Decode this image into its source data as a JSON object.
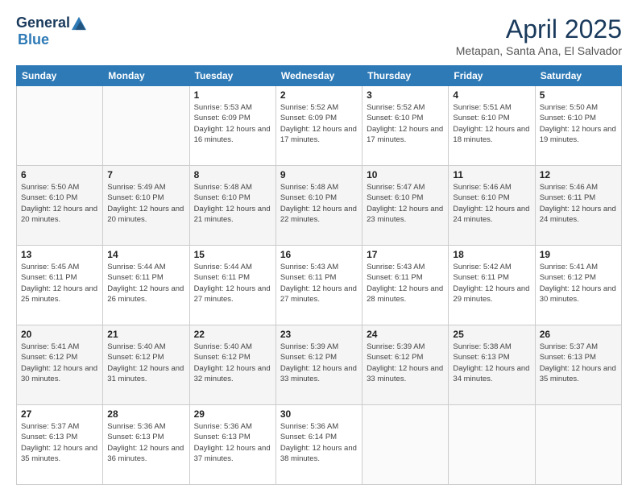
{
  "logo": {
    "general": "General",
    "blue": "Blue"
  },
  "header": {
    "title": "April 2025",
    "location": "Metapan, Santa Ana, El Salvador"
  },
  "days_of_week": [
    "Sunday",
    "Monday",
    "Tuesday",
    "Wednesday",
    "Thursday",
    "Friday",
    "Saturday"
  ],
  "weeks": [
    [
      {
        "num": "",
        "info": ""
      },
      {
        "num": "",
        "info": ""
      },
      {
        "num": "1",
        "info": "Sunrise: 5:53 AM\nSunset: 6:09 PM\nDaylight: 12 hours and 16 minutes."
      },
      {
        "num": "2",
        "info": "Sunrise: 5:52 AM\nSunset: 6:09 PM\nDaylight: 12 hours and 17 minutes."
      },
      {
        "num": "3",
        "info": "Sunrise: 5:52 AM\nSunset: 6:10 PM\nDaylight: 12 hours and 17 minutes."
      },
      {
        "num": "4",
        "info": "Sunrise: 5:51 AM\nSunset: 6:10 PM\nDaylight: 12 hours and 18 minutes."
      },
      {
        "num": "5",
        "info": "Sunrise: 5:50 AM\nSunset: 6:10 PM\nDaylight: 12 hours and 19 minutes."
      }
    ],
    [
      {
        "num": "6",
        "info": "Sunrise: 5:50 AM\nSunset: 6:10 PM\nDaylight: 12 hours and 20 minutes."
      },
      {
        "num": "7",
        "info": "Sunrise: 5:49 AM\nSunset: 6:10 PM\nDaylight: 12 hours and 20 minutes."
      },
      {
        "num": "8",
        "info": "Sunrise: 5:48 AM\nSunset: 6:10 PM\nDaylight: 12 hours and 21 minutes."
      },
      {
        "num": "9",
        "info": "Sunrise: 5:48 AM\nSunset: 6:10 PM\nDaylight: 12 hours and 22 minutes."
      },
      {
        "num": "10",
        "info": "Sunrise: 5:47 AM\nSunset: 6:10 PM\nDaylight: 12 hours and 23 minutes."
      },
      {
        "num": "11",
        "info": "Sunrise: 5:46 AM\nSunset: 6:10 PM\nDaylight: 12 hours and 24 minutes."
      },
      {
        "num": "12",
        "info": "Sunrise: 5:46 AM\nSunset: 6:11 PM\nDaylight: 12 hours and 24 minutes."
      }
    ],
    [
      {
        "num": "13",
        "info": "Sunrise: 5:45 AM\nSunset: 6:11 PM\nDaylight: 12 hours and 25 minutes."
      },
      {
        "num": "14",
        "info": "Sunrise: 5:44 AM\nSunset: 6:11 PM\nDaylight: 12 hours and 26 minutes."
      },
      {
        "num": "15",
        "info": "Sunrise: 5:44 AM\nSunset: 6:11 PM\nDaylight: 12 hours and 27 minutes."
      },
      {
        "num": "16",
        "info": "Sunrise: 5:43 AM\nSunset: 6:11 PM\nDaylight: 12 hours and 27 minutes."
      },
      {
        "num": "17",
        "info": "Sunrise: 5:43 AM\nSunset: 6:11 PM\nDaylight: 12 hours and 28 minutes."
      },
      {
        "num": "18",
        "info": "Sunrise: 5:42 AM\nSunset: 6:11 PM\nDaylight: 12 hours and 29 minutes."
      },
      {
        "num": "19",
        "info": "Sunrise: 5:41 AM\nSunset: 6:12 PM\nDaylight: 12 hours and 30 minutes."
      }
    ],
    [
      {
        "num": "20",
        "info": "Sunrise: 5:41 AM\nSunset: 6:12 PM\nDaylight: 12 hours and 30 minutes."
      },
      {
        "num": "21",
        "info": "Sunrise: 5:40 AM\nSunset: 6:12 PM\nDaylight: 12 hours and 31 minutes."
      },
      {
        "num": "22",
        "info": "Sunrise: 5:40 AM\nSunset: 6:12 PM\nDaylight: 12 hours and 32 minutes."
      },
      {
        "num": "23",
        "info": "Sunrise: 5:39 AM\nSunset: 6:12 PM\nDaylight: 12 hours and 33 minutes."
      },
      {
        "num": "24",
        "info": "Sunrise: 5:39 AM\nSunset: 6:12 PM\nDaylight: 12 hours and 33 minutes."
      },
      {
        "num": "25",
        "info": "Sunrise: 5:38 AM\nSunset: 6:13 PM\nDaylight: 12 hours and 34 minutes."
      },
      {
        "num": "26",
        "info": "Sunrise: 5:37 AM\nSunset: 6:13 PM\nDaylight: 12 hours and 35 minutes."
      }
    ],
    [
      {
        "num": "27",
        "info": "Sunrise: 5:37 AM\nSunset: 6:13 PM\nDaylight: 12 hours and 35 minutes."
      },
      {
        "num": "28",
        "info": "Sunrise: 5:36 AM\nSunset: 6:13 PM\nDaylight: 12 hours and 36 minutes."
      },
      {
        "num": "29",
        "info": "Sunrise: 5:36 AM\nSunset: 6:13 PM\nDaylight: 12 hours and 37 minutes."
      },
      {
        "num": "30",
        "info": "Sunrise: 5:36 AM\nSunset: 6:14 PM\nDaylight: 12 hours and 38 minutes."
      },
      {
        "num": "",
        "info": ""
      },
      {
        "num": "",
        "info": ""
      },
      {
        "num": "",
        "info": ""
      }
    ]
  ]
}
